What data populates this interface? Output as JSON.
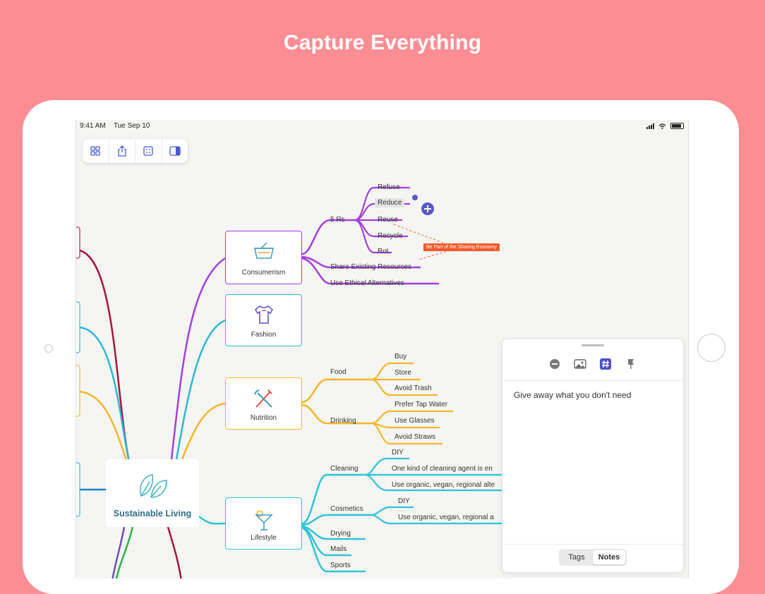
{
  "headline": "Capture Everything",
  "status": {
    "time": "9:41 AM",
    "date": "Tue Sep 10"
  },
  "central_topic": "Sustainable Living",
  "topics": {
    "consumerism": "Consumerism",
    "fashion": "Fashion",
    "nutrition": "Nutrition",
    "lifestyle": "Lifestyle"
  },
  "consumerism_branches": {
    "five_rs": "5 Rs",
    "refuse": "Refuse",
    "reduce": "Reduce",
    "reuse": "Reuse",
    "recycle": "Recycle",
    "rot": "Rot",
    "share": "Share Existing Resources",
    "ethical": "Use Ethical Alternatives"
  },
  "callout": "Be Part of the Sharing Economy",
  "nutrition_branches": {
    "food": "Food",
    "buy": "Buy",
    "store": "Store",
    "avoid_trash": "Avoid Trash",
    "drinking": "Drinking",
    "tap_water": "Prefer Tap Water",
    "glasses": "Use Glasses",
    "straws": "Avoid Straws"
  },
  "lifestyle_branches": {
    "cleaning": "Cleaning",
    "diy1": "DIY",
    "cleaning_agent": "One kind of cleaning agent is en",
    "organic1": "Use organic, vegan, regional alte",
    "cosmetics": "Cosmetics",
    "diy2": "DIY",
    "organic2": "Use organic, vegan, regional a",
    "drying": "Drying",
    "mails": "Mails",
    "sports": "Sports"
  },
  "notes_panel": {
    "note_text": "Give away what you don't need",
    "tab_tags": "Tags",
    "tab_notes": "Notes",
    "icons": [
      "minus-circle-icon",
      "image-icon",
      "tag-icon",
      "flag-icon"
    ]
  },
  "toolbar_icons": [
    "grid-icon",
    "share-icon",
    "outline-icon",
    "sidebar-icon"
  ],
  "colors": {
    "background": "#fc8e93",
    "consumerism": "#a43fd8",
    "fashion": "#2ab8d8",
    "nutrition": "#f5b629",
    "lifestyle": "#30c3d6",
    "callout": "#f05a2a",
    "central_text": "#2e6f89"
  }
}
